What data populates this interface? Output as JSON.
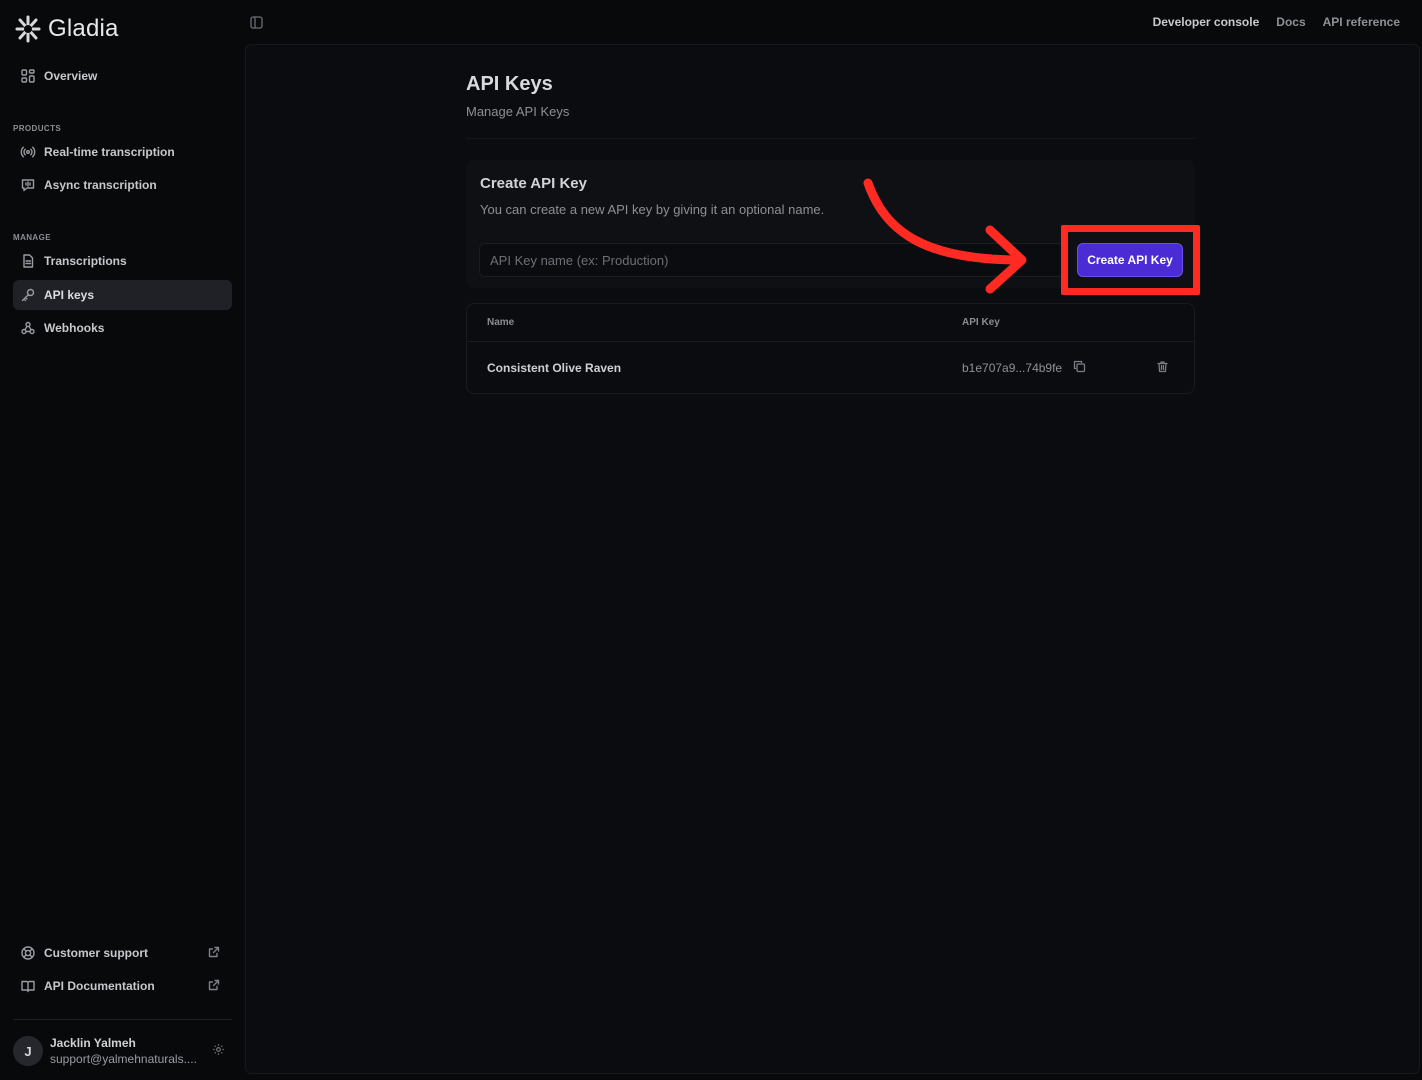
{
  "brand": {
    "name": "Gladia"
  },
  "sidebar": {
    "overview": "Overview",
    "products_label": "PRODUCTS",
    "products": [
      {
        "label": "Real-time transcription",
        "icon": "broadcast-icon"
      },
      {
        "label": "Async transcription",
        "icon": "chat-audio-icon"
      }
    ],
    "manage_label": "MANAGE",
    "manage": [
      {
        "label": "Transcriptions",
        "icon": "document-icon"
      },
      {
        "label": "API keys",
        "icon": "key-icon",
        "active": true
      },
      {
        "label": "Webhooks",
        "icon": "webhook-icon"
      }
    ],
    "footer_links": [
      {
        "label": "Customer support",
        "icon": "lifebuoy-icon"
      },
      {
        "label": "API Documentation",
        "icon": "book-icon"
      }
    ],
    "user": {
      "initial": "J",
      "name": "Jacklin Yalmeh",
      "email": "support@yalmehnaturals...."
    }
  },
  "topbar": {
    "links": [
      "Developer console",
      "Docs",
      "API reference"
    ]
  },
  "page": {
    "title": "API Keys",
    "subtitle": "Manage API Keys"
  },
  "create_card": {
    "title": "Create API Key",
    "description": "You can create a new API key by giving it an optional name.",
    "input_placeholder": "API Key name (ex: Production)",
    "button_label": "Create API Key"
  },
  "keys_table": {
    "columns": [
      "Name",
      "API Key"
    ],
    "rows": [
      {
        "name": "Consistent Olive Raven",
        "key": "b1e707a9...74b9fe"
      }
    ]
  },
  "colors": {
    "accent": "#4a2bd4",
    "annotation": "#ff2a22",
    "background": "#08090b"
  }
}
